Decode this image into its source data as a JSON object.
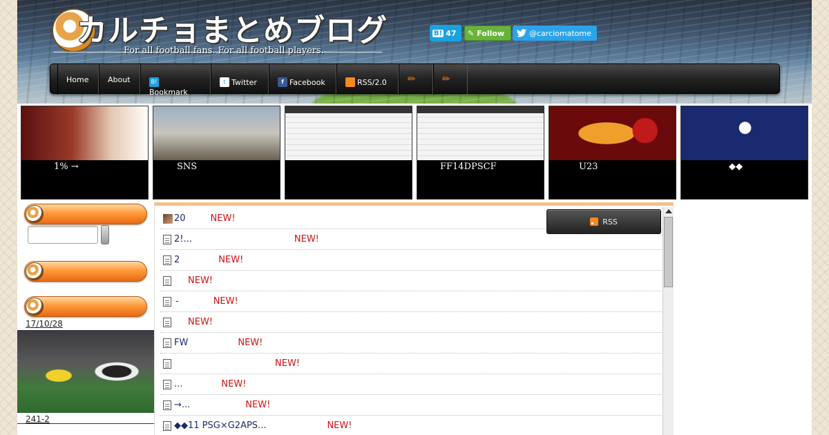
{
  "header": {
    "site_title": "カルチョまとめブログ",
    "subtitle": "For all football fans.  For all football players.",
    "hatena_count": "47",
    "hatena_icon": "B!",
    "follow_label": "Follow",
    "twitter_handle": "@carciomatome"
  },
  "nav": {
    "items": [
      {
        "label": "Home"
      },
      {
        "label": "About"
      },
      {
        "label": "Bookmark",
        "icon": "B!"
      },
      {
        "label": "Twitter"
      },
      {
        "label": "Facebook",
        "icon": "f"
      },
      {
        "label": "RSS/2.0"
      },
      {
        "label": "pen-icon"
      },
      {
        "label": "pen-icon"
      }
    ]
  },
  "features": [
    {
      "label": "1% →"
    },
    {
      "label": "SNS"
    },
    {
      "label": ""
    },
    {
      "label": "FF14DPSCF"
    },
    {
      "label": "U23"
    },
    {
      "label": "◆◆"
    }
  ],
  "sidebar": {
    "date": "17/10/28",
    "caption": "241-2"
  },
  "main": {
    "rss_label": "RSS",
    "new_label": "NEW!",
    "items": [
      {
        "title": "20"
      },
      {
        "title": "2!..."
      },
      {
        "title": "2"
      },
      {
        "title": ""
      },
      {
        "title": "-"
      },
      {
        "title": ""
      },
      {
        "title": "FW"
      },
      {
        "title": ""
      },
      {
        "title": "..."
      },
      {
        "title": "→..."
      },
      {
        "title": "◆◆11 PSG×G2APS..."
      }
    ]
  },
  "colors": {
    "accent": "#ff9a3c",
    "new_badge": "#d01010",
    "nav_bg": "#222222"
  }
}
